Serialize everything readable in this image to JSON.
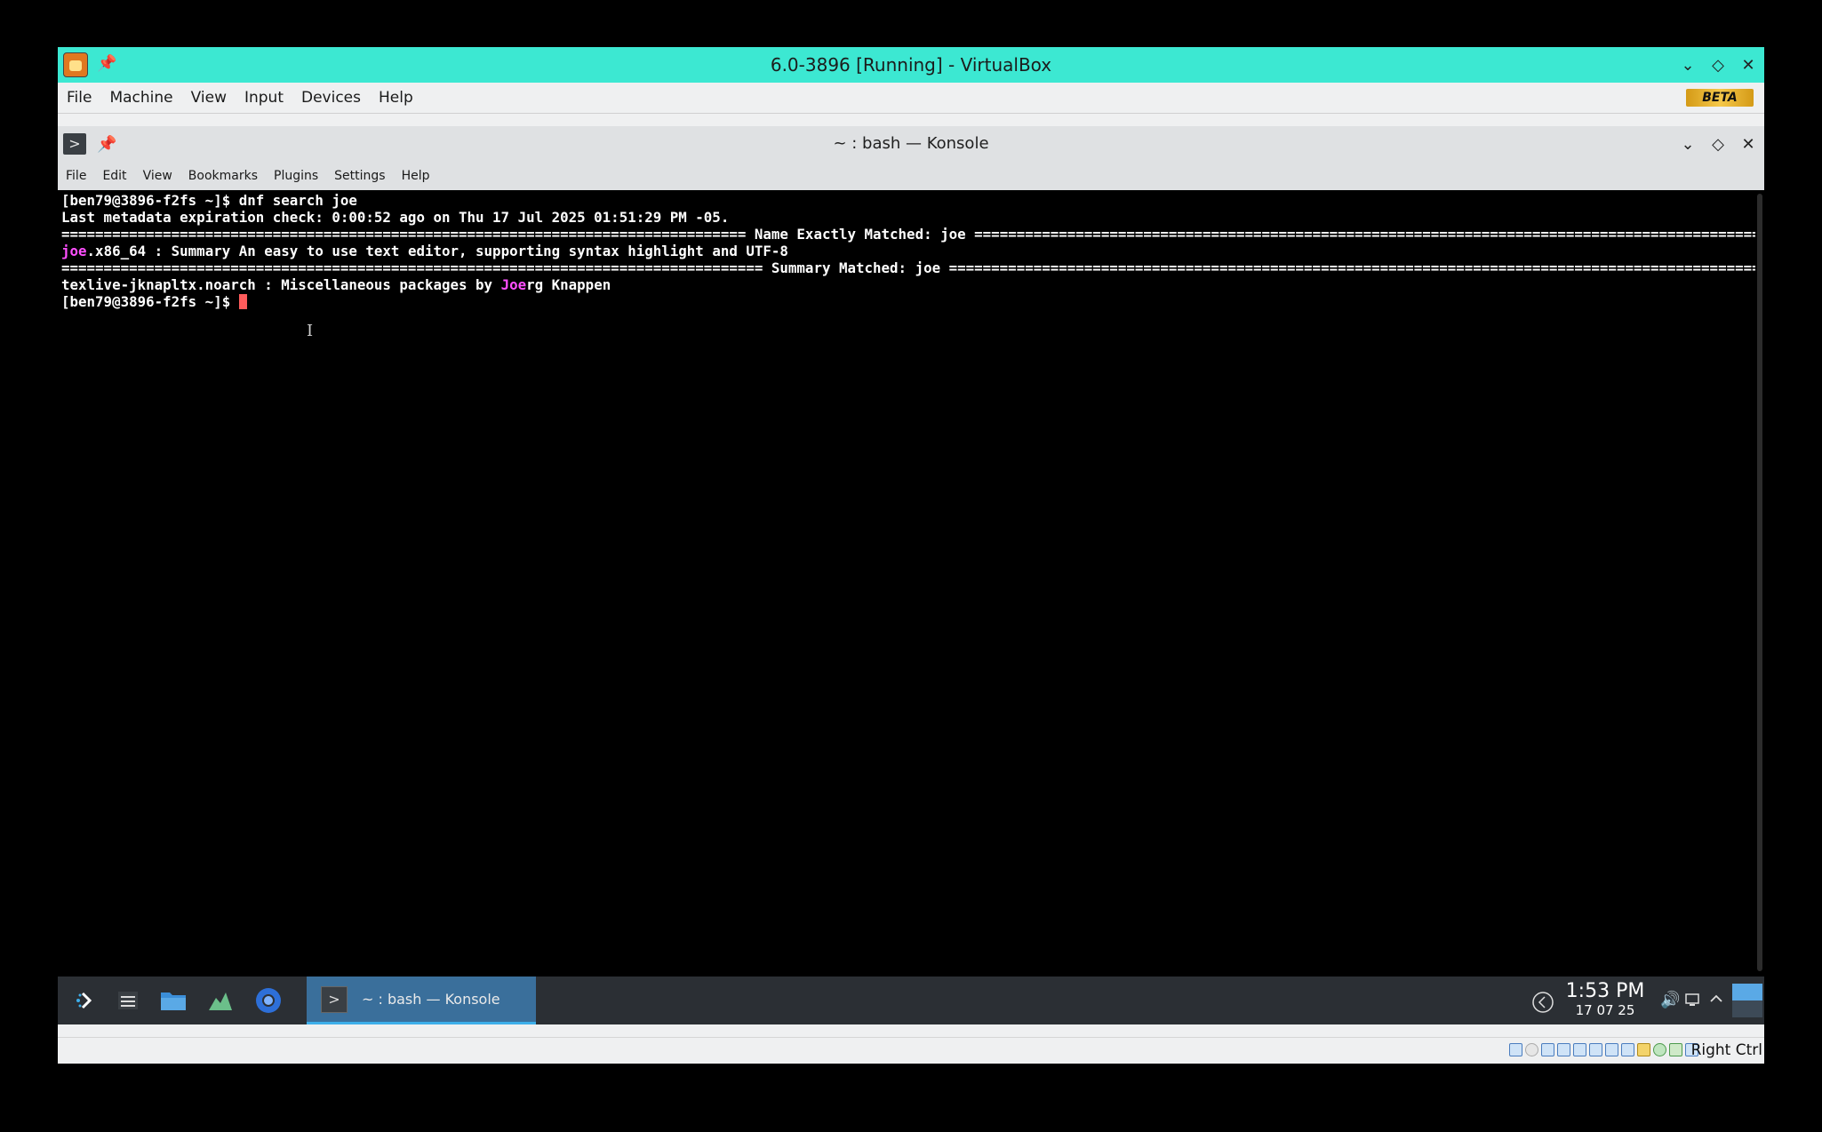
{
  "vbox": {
    "title": "6.0-3896 [Running] - VirtualBox",
    "menu": [
      "File",
      "Machine",
      "View",
      "Input",
      "Devices",
      "Help"
    ],
    "beta_badge": "BETA",
    "accent_color": "#3ce8d2",
    "host_key": "Right Ctrl"
  },
  "konsole": {
    "title": "~ : bash — Konsole",
    "menu": [
      "File",
      "Edit",
      "View",
      "Bookmarks",
      "Plugins",
      "Settings",
      "Help"
    ]
  },
  "terminal": {
    "prompt": "[ben79@3896-f2fs ~]$ ",
    "command": "dnf search joe",
    "metadata_line": "Last metadata expiration check: 0:00:52 ago on Thu 17 Jul 2025 01:51:29 PM -05.",
    "section1_left": "=================================================================================",
    "section1_title": " Name Exactly Matched: joe ",
    "section1_right": "==============================================================================================================================================================",
    "result1_hl": "joe",
    "result1_rest": ".x86_64 : Summary An easy to use text editor, supporting syntax highlight and UTF-8",
    "section2_left": "===================================================================================",
    "section2_title": " Summary Matched: joe ",
    "section2_right": "================================================================================================================================================================",
    "result2_before": "texlive-jknapltx.noarch : Miscellaneous packages by ",
    "result2_hl": "Joe",
    "result2_after": "rg Knappen",
    "highlight_color": "#ff4fff",
    "cursor_color": "#ff5c5c"
  },
  "taskbar": {
    "task_label": "~ : bash — Konsole",
    "time": "1:53 PM",
    "date": "17 07 25"
  }
}
